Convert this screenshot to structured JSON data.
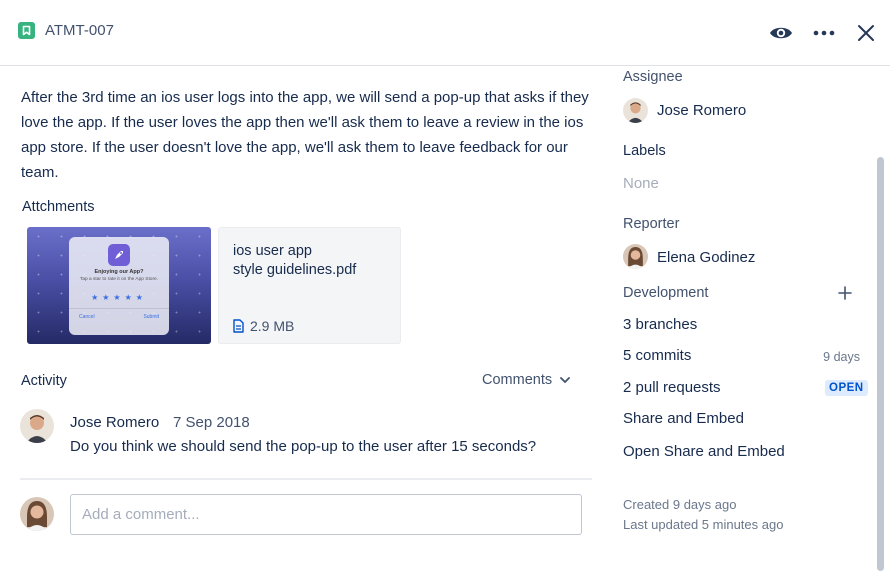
{
  "header": {
    "issue_key": "ATMT-007",
    "icons": {
      "issue_type": "story-icon",
      "watch": "eye-icon",
      "more": "more-icon",
      "close": "close-icon"
    }
  },
  "description": "After the 3rd time an ios user logs into the app, we will send a pop-up that asks if they love the app. If the user loves the app then we'll ask them to leave a review in the ios app store. If the user doesn't love the app, we'll ask them to leave feedback for our team.",
  "attachments": {
    "title": "Attchments",
    "image_preview": {
      "dialog_title": "Enjoying our App?",
      "dialog_text": "Tap a star to rate it on the App Store.",
      "stars": "★★★★★",
      "cancel": "Cancel",
      "submit": "Submit"
    },
    "file": {
      "name_line1": "ios user app",
      "name_line2": "style guidelines.pdf",
      "size": "2.9 MB"
    }
  },
  "activity": {
    "title": "Activity",
    "filter": "Comments",
    "comments": [
      {
        "author": "Jose Romero",
        "date": "7 Sep 2018",
        "text": "Do you think we should send the pop-up to the user after 15 seconds?"
      }
    ],
    "input_placeholder": "Add a comment..."
  },
  "sidebar": {
    "assignee_label": "Assignee",
    "assignee": "Jose Romero",
    "labels_label": "Labels",
    "labels_value": "None",
    "reporter_label": "Reporter",
    "reporter": "Elena Godinez",
    "development_label": "Development",
    "branches": "3 branches",
    "commits": "5 commits",
    "commits_meta": "9 days",
    "pull_requests": "2 pull requests",
    "pr_status": "OPEN",
    "share": "Share and Embed",
    "open_share": "Open Share and Embed",
    "created": "Created 9 days ago",
    "updated": "Last updated 5 minutes ago"
  },
  "colors": {
    "story": "#36b37e",
    "text": "#172b4d",
    "muted": "#6b778c",
    "badge_bg": "#deebff",
    "badge_text": "#0052cc"
  }
}
